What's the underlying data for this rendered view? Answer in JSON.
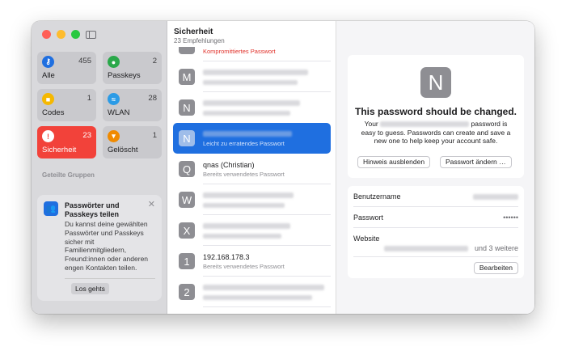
{
  "window": {
    "sidebar_toggle_icon": "sidebar-icon",
    "categories": [
      {
        "label": "Alle",
        "count": "455",
        "icon": "key-icon",
        "color": "#1f6fe0",
        "glyph": "⚷"
      },
      {
        "label": "Passkeys",
        "count": "2",
        "icon": "person-key-icon",
        "color": "#2aa84a",
        "glyph": "●"
      },
      {
        "label": "Codes",
        "count": "1",
        "icon": "lock-code-icon",
        "color": "#f5b800",
        "glyph": "■"
      },
      {
        "label": "WLAN",
        "count": "28",
        "icon": "wifi-icon",
        "color": "#2b9be6",
        "glyph": "≈"
      },
      {
        "label": "Sicherheit",
        "count": "23",
        "icon": "exclamation-icon",
        "color": "#ffffff",
        "glyph": "!"
      },
      {
        "label": "Gelöscht",
        "count": "1",
        "icon": "trash-icon",
        "color": "#f08a00",
        "glyph": "▾"
      }
    ],
    "groups_label": "Geteilte Gruppen",
    "share_card": {
      "title": "Passwörter und Passkeys teilen",
      "body": "Du kannst deine gewählten Passwörter und Passkeys sicher mit Familienmitgliedern, Freund:innen oder anderen engen Kontakten teilen.",
      "button": "Los gehts",
      "close_glyph": "✕",
      "icon_glyph": "👥"
    }
  },
  "list": {
    "title": "Sicherheit",
    "subtitle": "23 Empfehlungen",
    "rows": [
      {
        "letter": "",
        "sub": "Kompromittiertes Passwort"
      },
      {
        "letter": "M",
        "sub": ""
      },
      {
        "letter": "N",
        "sub": ""
      },
      {
        "letter": "N",
        "sub": "Leicht zu erratendes Passwort"
      },
      {
        "letter": "Q",
        "name": "qnas (Christian)",
        "sub": "Bereits verwendetes Passwort"
      },
      {
        "letter": "W",
        "sub": ""
      },
      {
        "letter": "X",
        "sub": ""
      },
      {
        "letter": "1",
        "name": "192.168.178.3",
        "sub": "Bereits verwendetes Passwort"
      },
      {
        "letter": "2",
        "sub": ""
      }
    ]
  },
  "detail": {
    "avatar_letter": "N",
    "warning_title": "This password should be changed.",
    "warning_text_1": "Your",
    "warning_text_2": "password is easy to guess. Passwords can create and save a new one to help keep your account safe.",
    "hide_button": "Hinweis ausblenden",
    "change_button": "Passwort ändern …",
    "fields": {
      "username_label": "Benutzername",
      "password_label": "Passwort",
      "password_value": "••••••",
      "website_label": "Website",
      "website_more": "und 3 weitere"
    },
    "edit_button": "Bearbeiten"
  }
}
